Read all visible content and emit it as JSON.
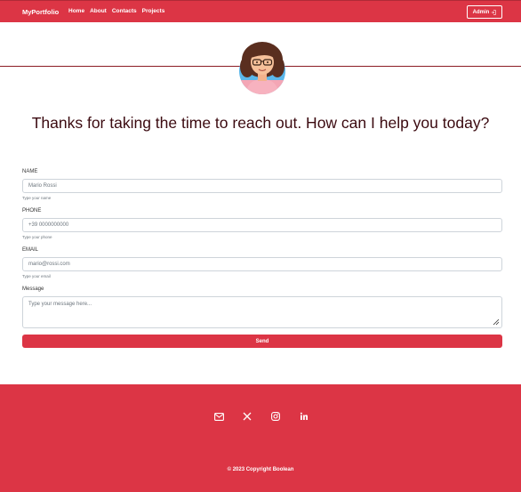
{
  "navbar": {
    "brand": "MyPortfolio",
    "links": [
      "Home",
      "About",
      "Contacts",
      "Projects"
    ],
    "admin_label": "Admin"
  },
  "heading": "Thanks for taking the time to reach out. How can I help you today?",
  "form": {
    "name": {
      "label": "NAME",
      "value": "Mario Rossi",
      "hint": "Type your name"
    },
    "phone": {
      "label": "PHONE",
      "value": "+39 0000000000",
      "hint": "Type your phone"
    },
    "email": {
      "label": "EMAIL",
      "value": "mario@rossi.com",
      "hint": "Type your email"
    },
    "message": {
      "label": "Message",
      "placeholder": "Type your message here..."
    },
    "send_label": "Send"
  },
  "footer": {
    "socials": [
      "envelope-icon",
      "x-twitter-icon",
      "instagram-icon",
      "linkedin-icon"
    ],
    "copyright": "© 2023 Copyright Boolean"
  },
  "colors": {
    "accent": "#dc3545",
    "heading": "#3b0a10",
    "divider": "#8b1c24"
  }
}
